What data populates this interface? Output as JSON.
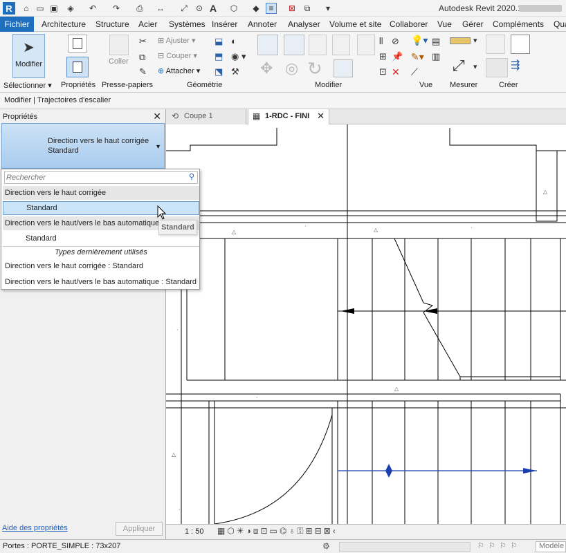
{
  "app": {
    "title": "Autodesk Revit 2020.1 -",
    "logo": "R"
  },
  "ribbon_tabs": {
    "file": "Fichier",
    "items": [
      "Architecture",
      "Structure",
      "Acier",
      "Systèmes",
      "Insérer",
      "Annoter",
      "Analyser",
      "Volume et site",
      "Collaborer",
      "Vue",
      "Gérer",
      "Compléments",
      "Qua"
    ]
  },
  "ribbon": {
    "modify_label": "Modifier",
    "properties_label": "Propriétés",
    "paste_label": "Coller",
    "adjust_label": "Ajuster",
    "cut_label": "Couper",
    "attach_label": "Attacher",
    "panels": {
      "select": "Sélectionner",
      "properties": "Propriétés",
      "clipboard": "Presse-papiers",
      "geometry": "Géométrie",
      "modify": "Modifier",
      "view": "Vue",
      "measure": "Mesurer",
      "create": "Créer"
    }
  },
  "context_bar": {
    "text": "Modifier | Trajectoires d'escalier"
  },
  "properties_panel": {
    "title": "Propriétés",
    "type_family": "Direction vers le haut corrigée",
    "type_name": "Standard",
    "help_link": "Aide des propriétés",
    "apply_button": "Appliquer"
  },
  "type_dropdown": {
    "search_placeholder": "Rechercher",
    "group1": "Direction vers le haut corrigée",
    "group1_item": "Standard",
    "group2": "Direction vers le haut/vers le bas automatique",
    "group2_item": "Standard",
    "recent_header": "Types dernièrement utilisés",
    "recent1": "Direction vers le haut corrigée : Standard",
    "recent2": "Direction vers le haut/vers le bas automatique : Standard",
    "tooltip": "Standard"
  },
  "view_tabs": {
    "tab1": "Coupe 1",
    "tab2": "1-RDC - FINI"
  },
  "view_bar": {
    "scale": "1 : 50"
  },
  "status_bar": {
    "text": "Portes : PORTE_SIMPLE : 73x207",
    "model": "Modèle"
  },
  "colors": {
    "accent": "#1f6fbf",
    "selection": "#cce4f7",
    "path_blue": "#1b3fae"
  }
}
